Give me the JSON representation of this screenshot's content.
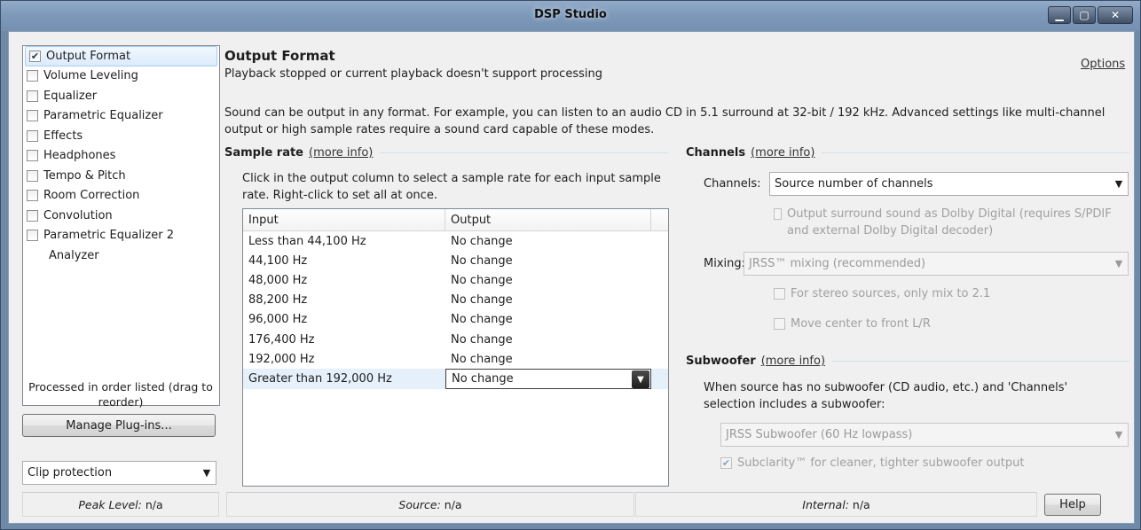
{
  "window": {
    "title": "DSP Studio",
    "controls": [
      "minimize-icon",
      "maximize-icon",
      "close-icon"
    ]
  },
  "plugins": {
    "items": [
      {
        "label": "Output Format",
        "checked": true,
        "has_checkbox": true,
        "selected": true
      },
      {
        "label": "Volume Leveling",
        "checked": false,
        "has_checkbox": true
      },
      {
        "label": "Equalizer",
        "checked": false,
        "has_checkbox": true
      },
      {
        "label": "Parametric Equalizer",
        "checked": false,
        "has_checkbox": true
      },
      {
        "label": "Effects",
        "checked": false,
        "has_checkbox": true
      },
      {
        "label": "Headphones",
        "checked": false,
        "has_checkbox": true
      },
      {
        "label": "Tempo & Pitch",
        "checked": false,
        "has_checkbox": true
      },
      {
        "label": "Room Correction",
        "checked": false,
        "has_checkbox": true
      },
      {
        "label": "Convolution",
        "checked": false,
        "has_checkbox": true
      },
      {
        "label": "Parametric Equalizer 2",
        "checked": false,
        "has_checkbox": true
      },
      {
        "label": "Analyzer",
        "checked": false,
        "has_checkbox": false
      }
    ],
    "order_note": "Processed in order listed (drag to reorder)",
    "manage_button": "Manage Plug-ins...",
    "clip_protection": "Clip protection"
  },
  "main": {
    "title": "Output Format",
    "subtitle": "Playback stopped or current playback doesn't support processing",
    "options_link": "Options",
    "description": "Sound can be output in any format.  For example, you can listen to an audio CD in 5.1 surround at 32-bit / 192 kHz.  Advanced settings like multi-channel output or high sample rates require a sound card capable of these modes."
  },
  "sample_rate": {
    "heading": "Sample rate",
    "more_info": "(more info)",
    "help": "Click in the output column to select a sample rate for each input sample rate.  Right-click to set all at once.",
    "columns": [
      "Input",
      "Output"
    ],
    "rows": [
      {
        "input": "Less than 44,100 Hz",
        "output": "No change"
      },
      {
        "input": "44,100 Hz",
        "output": "No change"
      },
      {
        "input": "48,000 Hz",
        "output": "No change"
      },
      {
        "input": "88,200 Hz",
        "output": "No change"
      },
      {
        "input": "96,000 Hz",
        "output": "No change"
      },
      {
        "input": "176,400 Hz",
        "output": "No change"
      },
      {
        "input": "192,000 Hz",
        "output": "No change"
      },
      {
        "input": "Greater than 192,000 Hz",
        "output": "No change",
        "selected": true
      }
    ]
  },
  "channels": {
    "heading": "Channels",
    "more_info": "(more info)",
    "channels_label": "Channels:",
    "channels_value": "Source number of channels",
    "dolby_option": "Output surround sound as Dolby Digital (requires S/PDIF and external Dolby Digital decoder)",
    "mixing_label": "Mixing:",
    "mixing_value": "JRSS™ mixing (recommended)",
    "stereo_option": "For stereo sources, only mix to 2.1",
    "center_option": "Move center to front L/R"
  },
  "subwoofer": {
    "heading": "Subwoofer",
    "more_info": "(more info)",
    "desc": "When source has no subwoofer (CD audio, etc.) and 'Channels' selection includes a subwoofer:",
    "value": "JRSS Subwoofer (60 Hz lowpass)",
    "subclarity": "Subclarity™ for cleaner, tighter subwoofer output",
    "subclarity_checked": true
  },
  "status": {
    "peak_label": "Peak Level:",
    "peak_value": "n/a",
    "source_label": "Source:",
    "source_value": "n/a",
    "internal_label": "Internal:",
    "internal_value": "n/a",
    "help_button": "Help"
  }
}
